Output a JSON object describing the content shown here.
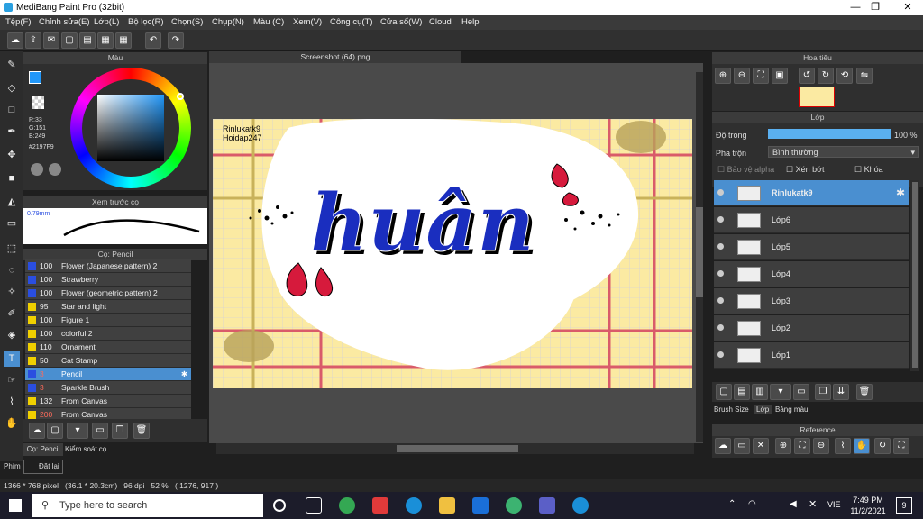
{
  "window": {
    "title": "MediBang Paint Pro (32bit)"
  },
  "menu": [
    "Tệp(F)",
    "Chỉnh sửa(E)",
    "Lớp(L)",
    "Bộ lọc(R)",
    "Chọn(S)",
    "Chụp(N)",
    "Màu (C)",
    "Xem(V)",
    "Công cụ(T)",
    "Cửa sổ(W)",
    "Cloud",
    "Help"
  ],
  "color_panel": {
    "title": "Màu",
    "r": "R:33",
    "g": "G:151",
    "b": "B:249",
    "hex": "#2197F9"
  },
  "brush_preview": {
    "title": "Xem trước cọ",
    "size": "0.79mm"
  },
  "brush_panel": {
    "title": "Cọ: Pencil",
    "items": [
      {
        "size": "100",
        "name": "Flower (Japanese pattern) 2",
        "color": "#2a4ee0"
      },
      {
        "size": "100",
        "name": "Strawberry",
        "color": "#2a4ee0"
      },
      {
        "size": "100",
        "name": "Flower (geometric pattern) 2",
        "color": "#2a4ee0"
      },
      {
        "size": "95",
        "name": "Star and light",
        "color": "#f0d000"
      },
      {
        "size": "100",
        "name": "Figure 1",
        "color": "#f0d000"
      },
      {
        "size": "100",
        "name": "colorful 2",
        "color": "#f0d000"
      },
      {
        "size": "110",
        "name": "Ornament",
        "color": "#f0d000"
      },
      {
        "size": "50",
        "name": "Cat Stamp",
        "color": "#f0d000"
      },
      {
        "size": "3",
        "name": "Pencil",
        "color": "#2a4ee0"
      },
      {
        "size": "3",
        "name": "Sparkle Brush",
        "color": "#2a4ee0"
      },
      {
        "size": "132",
        "name": "From Canvas",
        "color": "#f0d000"
      },
      {
        "size": "200",
        "name": "From Canvas",
        "color": "#f0d000"
      }
    ],
    "tabs": [
      "Cọ: Pencil",
      "Kiểm soát cọ"
    ]
  },
  "bottom_left": {
    "label": "Phím",
    "reset": "Đặt lại"
  },
  "document": {
    "tab": "Screenshot (64).png",
    "watermark1": "Rinlukatk9",
    "watermark2": "Hoidap247",
    "art_text": "huân"
  },
  "navigator": {
    "title": "Hoa tiêu"
  },
  "layer_panel": {
    "title": "Lớp",
    "opacity_label": "Độ trong",
    "opacity_value": "100 %",
    "opacity": 1.0,
    "blend_label": "Pha trộn",
    "blend_value": "Bình thường",
    "opt_alpha": "Bảo vệ alpha",
    "opt_clip": "Xén bớt",
    "opt_lock": "Khóa",
    "layers": [
      "Rinlukatk9",
      "Lớp6",
      "Lớp5",
      "Lớp4",
      "Lớp3",
      "Lớp2",
      "Lớp1"
    ],
    "tabs": [
      "Brush Size",
      "Lớp",
      "Bảng màu"
    ]
  },
  "reference": {
    "title": "Reference"
  },
  "status": {
    "text": "1366 * 768 pixel   (36.1 * 20.3cm)   96 dpi   52 %   ( 1276, 917 )"
  },
  "taskbar": {
    "search": "Type here to search",
    "lang": "VIE",
    "time": "7:49 PM",
    "date": "11/2/2021",
    "notif": "9"
  }
}
